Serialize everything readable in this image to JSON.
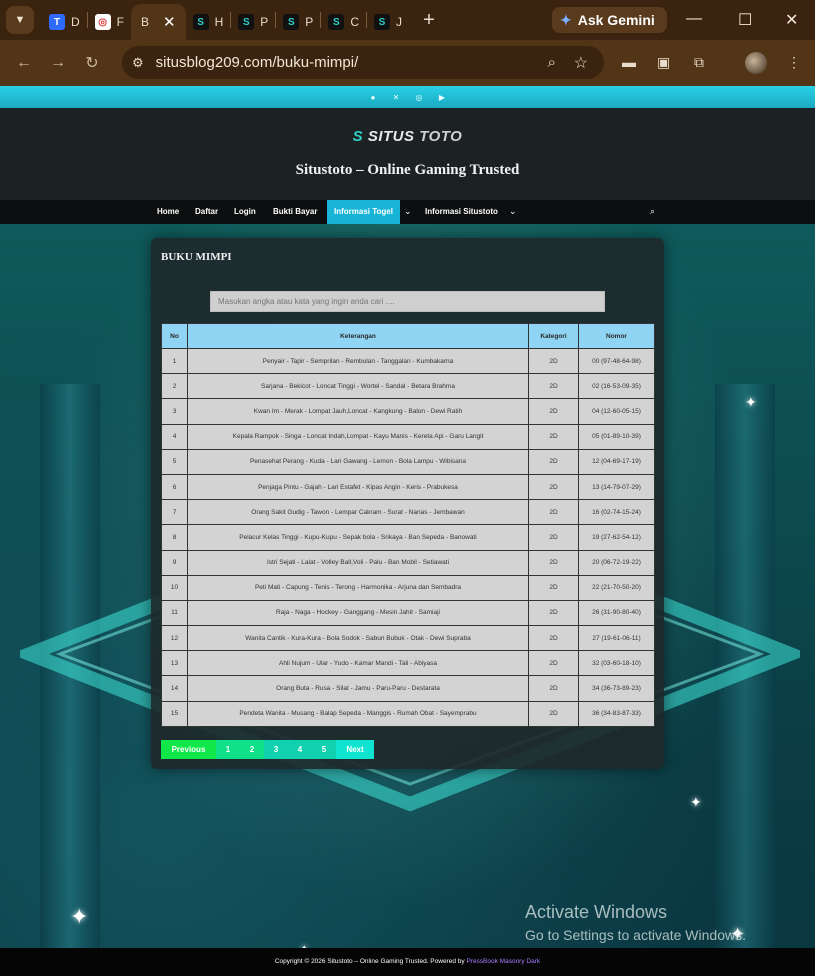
{
  "browser": {
    "tabs": [
      {
        "favicon_text": "T",
        "favicon_color": "#2f6bff",
        "label": "D"
      },
      {
        "favicon_text": "◎",
        "favicon_color": "#ffffff",
        "label": "F"
      },
      {
        "favicon_text": "",
        "favicon_color": "",
        "label": "B",
        "active": true
      },
      {
        "favicon_text": "S",
        "favicon_color": "#111",
        "label": "H"
      },
      {
        "favicon_text": "S",
        "favicon_color": "#111",
        "label": "P"
      },
      {
        "favicon_text": "S",
        "favicon_color": "#111",
        "label": "P"
      },
      {
        "favicon_text": "S",
        "favicon_color": "#111",
        "label": "C"
      },
      {
        "favicon_text": "S",
        "favicon_color": "#111",
        "label": "J"
      }
    ],
    "gemini_label": "Ask Gemini",
    "url": "situsblog209.com/buku-mimpi/"
  },
  "site": {
    "logo_word1": "SITUS",
    "logo_word2": "TOTO",
    "title": "Situstoto – Online Gaming Trusted",
    "nav": [
      "Home",
      "Daftar",
      "Login",
      "Bukti Bayar",
      "Informasi Togel",
      "Informasi Situstoto"
    ]
  },
  "card": {
    "title": "BUKU MIMPI",
    "search_placeholder": "Masukan angka atau kata yang ingin anda cari ....",
    "headers": [
      "No",
      "Keterangan",
      "Kategori",
      "Nomor"
    ],
    "rows": [
      [
        "1",
        "Penyair - Tapir - Semprilan - Rembulan - Tanggalan - Kumbakarna",
        "2D",
        "00 (97-48-64-98)"
      ],
      [
        "2",
        "Sarjana - Bekicot - Loncat Tinggi - Wortel - Sandal - Betara Brahma",
        "2D",
        "02 (16-53-09-35)"
      ],
      [
        "3",
        "Kwan Im - Merak - Lompat Jauh,Loncat - Kangkung - Balon - Dewi Ratih",
        "2D",
        "04 (12-60-05-15)"
      ],
      [
        "4",
        "Kepala Rampok - Singa - Loncat Indah,Lompat - Kayu Manis - Kereta Api - Garu Langit",
        "2D",
        "05 (01-89-10-39)"
      ],
      [
        "5",
        "Penasehat Perang - Kuda - Lari Gawang - Lemon - Bola Lampu - Wibisana",
        "2D",
        "12 (04-69-17-19)"
      ],
      [
        "6",
        "Penjaga Pintu - Gajah - Lari Estafet - Kipas Angin - Keris - Prabukesa",
        "2D",
        "13 (14-79-07-29)"
      ],
      [
        "7",
        "Orang Sakit Gudig - Tawon - Lempar Cakram - Surat - Nanas - Jembawan",
        "2D",
        "16 (02-74-15-24)"
      ],
      [
        "8",
        "Pelacur Kelas Tinggi - Kupu-Kupu - Sepak bola - Srikaya - Ban Sepeda - Banowati",
        "2D",
        "19 (27-62-54-12)"
      ],
      [
        "9",
        "Istri Sejati - Lalat - Volley Ball,Voli - Palu - Ban Mobil - Setiawati",
        "2D",
        "20 (06-72-19-22)"
      ],
      [
        "10",
        "Peti Mati - Capung - Tenis - Terong - Harmonika - Arjuna dan Sembadra",
        "2D",
        "22 (21-70-50-20)"
      ],
      [
        "11",
        "Raja - Naga - Hockey - Ganggang - Mesin Jahit - Samiaji",
        "2D",
        "26 (31-90-80-40)"
      ],
      [
        "12",
        "Wanita Cantik - Kura-Kura - Bola Sodok - Sabun Bubuk - Otak - Dewi Supraba",
        "2D",
        "27 (19-61-06-11)"
      ],
      [
        "13",
        "Ahli Nujum - Ular - Yudo - Kamar Mandi - Tali - Abiyasa",
        "2D",
        "32 (03-60-18-10)"
      ],
      [
        "14",
        "Orang Buta - Rusa - Silat - Jamu - Paru-Paru - Destarata",
        "2D",
        "34 (36-73-89-23)"
      ],
      [
        "15",
        "Pendeta Wanita - Musang - Balap Sepeda - Manggis - Rumah Obat - Sayemprabu",
        "2D",
        "36 (34-83-87-33)"
      ]
    ],
    "pagination": {
      "prev": "Previous",
      "pages": [
        "1",
        "2",
        "3",
        "4",
        "5"
      ],
      "next": "Next"
    }
  },
  "watermark": {
    "line1": "Activate Windows",
    "line2": "Go to Settings to activate Windows."
  },
  "footer": {
    "text": "Copyright © 2026 Situstoto – Online Gaming Trusted. Powered by ",
    "link": "PressBook Masonry Dark"
  }
}
